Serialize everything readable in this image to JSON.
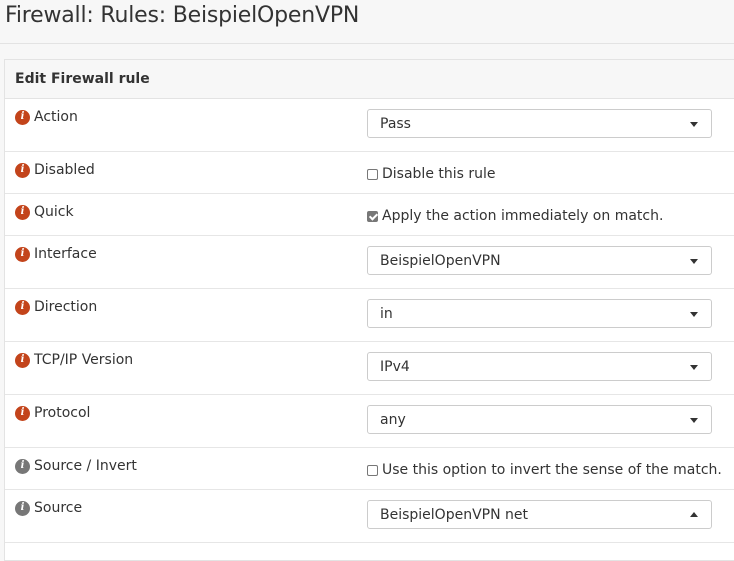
{
  "page": {
    "title": "Firewall: Rules: BeispielOpenVPN"
  },
  "panel": {
    "heading": "Edit Firewall rule"
  },
  "rows": {
    "action": {
      "label": "Action",
      "value": "Pass"
    },
    "disabled": {
      "label": "Disabled",
      "checkbox_label": "Disable this rule",
      "checked": false
    },
    "quick": {
      "label": "Quick",
      "checkbox_label": "Apply the action immediately on match.",
      "checked": true
    },
    "interface": {
      "label": "Interface",
      "value": "BeispielOpenVPN"
    },
    "direction": {
      "label": "Direction",
      "value": "in"
    },
    "ipversion": {
      "label": "TCP/IP Version",
      "value": "IPv4"
    },
    "protocol": {
      "label": "Protocol",
      "value": "any"
    },
    "source_invert": {
      "label": "Source / Invert",
      "checkbox_label": "Use this option to invert the sense of the match.",
      "checked": false
    },
    "source": {
      "label": "Source",
      "value": "BeispielOpenVPN net"
    }
  },
  "icons": {
    "info": "info-icon",
    "dropdown": "caret-down-icon",
    "dropup": "caret-up-icon",
    "info_color_active": "#c3441b",
    "info_color_neutral": "#777777"
  }
}
